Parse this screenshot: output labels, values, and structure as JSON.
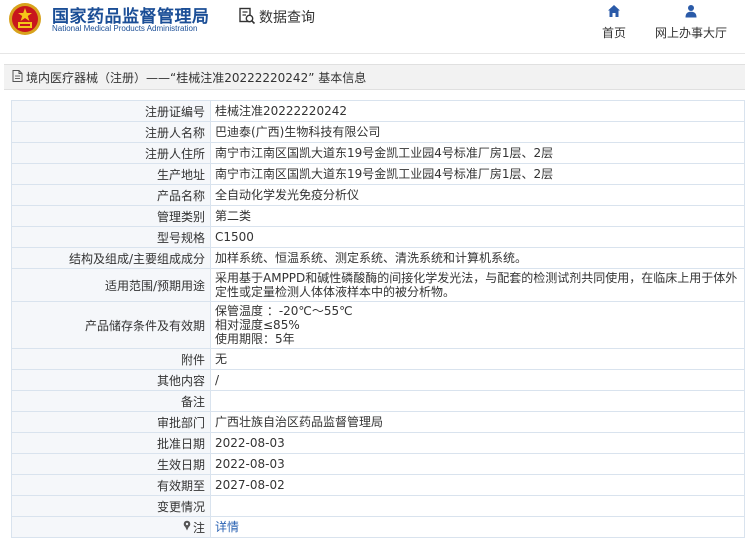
{
  "header": {
    "logo_cn": "国家药品监督管理局",
    "logo_en": "National Medical Products Administration",
    "data_query": "数据查询",
    "nav": [
      {
        "label": "首页",
        "icon": "home-icon"
      },
      {
        "label": "网上办事大厅",
        "icon": "user-icon"
      }
    ]
  },
  "title_bar": {
    "text": "境内医疗器械（注册）——“桂械注准20222220242” 基本信息",
    "icon": "document-icon"
  },
  "rows": [
    {
      "label": "注册证编号",
      "value": "桂械注准20222220242"
    },
    {
      "label": "注册人名称",
      "value": "巴迪泰(广西)生物科技有限公司"
    },
    {
      "label": "注册人住所",
      "value": "南宁市江南区国凯大道东19号金凯工业园4号标准厂房1层、2层"
    },
    {
      "label": "生产地址",
      "value": "南宁市江南区国凯大道东19号金凯工业园4号标准厂房1层、2层"
    },
    {
      "label": "产品名称",
      "value": "全自动化学发光免疫分析仪"
    },
    {
      "label": "管理类别",
      "value": "第二类"
    },
    {
      "label": "型号规格",
      "value": "C1500"
    },
    {
      "label": "结构及组成/主要组成成分",
      "value": "加样系统、恒温系统、测定系统、清洗系统和计算机系统。"
    },
    {
      "label": "适用范围/预期用途",
      "value": "采用基于AMPPD和碱性磷酸酶的间接化学发光法，与配套的检测试剂共同使用，在临床上用于体外定性或定量检测人体体液样本中的被分析物。"
    },
    {
      "label": "产品储存条件及有效期",
      "lines": [
        "保管温度 ：-20℃～55℃",
        "相对湿度≤85%",
        "使用期限：5年"
      ]
    },
    {
      "label": "附件",
      "value": "无"
    },
    {
      "label": "其他内容",
      "value": "/"
    },
    {
      "label": "备注",
      "value": ""
    },
    {
      "label": "审批部门",
      "value": "广西壮族自治区药品监督管理局"
    },
    {
      "label": "批准日期",
      "value": "2022-08-03"
    },
    {
      "label": "生效日期",
      "value": "2022-08-03"
    },
    {
      "label": "有效期至",
      "value": "2027-08-02"
    },
    {
      "label": "变更情况",
      "value": ""
    },
    {
      "label": "注",
      "value": "详情",
      "icon": "pin-icon"
    }
  ],
  "colors": {
    "brand": "#1b4e96",
    "emblem_red": "#c8161d",
    "link": "#2a62b3",
    "label_bg": "#f5f7fa",
    "border": "#d9e3ee"
  }
}
